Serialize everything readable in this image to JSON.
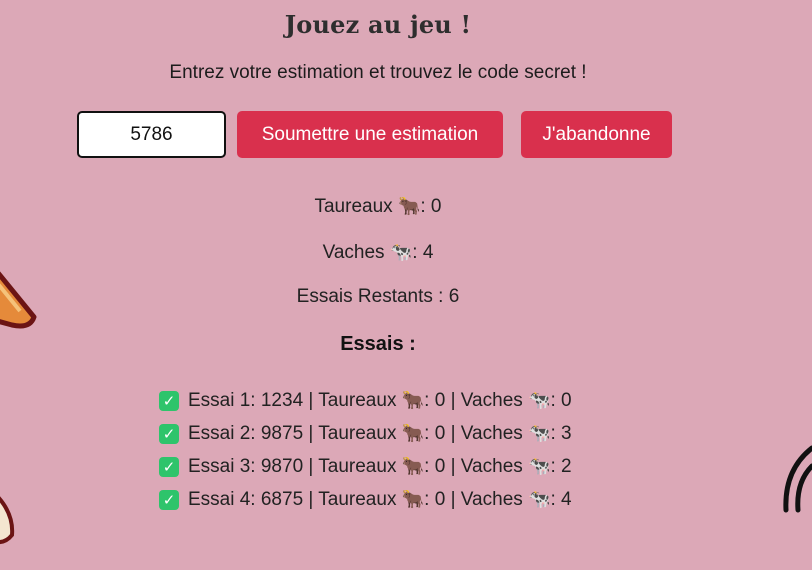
{
  "game": {
    "title": "Jouez au jeu !",
    "instructions": "Entrez votre estimation et trouvez le code secret !",
    "guess_value": "5786",
    "submit_label": "Soumettre une estimation",
    "give_up_label": "J'abandonne"
  },
  "stats": {
    "bulls_label": "Taureaux",
    "bull_icon": "🐂",
    "bulls_value": "0",
    "cows_label": "Vaches",
    "cow_icon": "🐄",
    "cows_value": "4",
    "remaining_label": "Essais Restants :",
    "remaining_value": "6"
  },
  "history": {
    "title": "Essais :",
    "check_icon": "check-box-icon",
    "attempts": [
      {
        "label": "Essai 1: 1234 | Taureaux",
        "bulls": "0",
        "cows_label": "| Vaches",
        "cows": "0"
      },
      {
        "label": "Essai 2: 9875 | Taureaux",
        "bulls": "0",
        "cows_label": "| Vaches",
        "cows": "3"
      },
      {
        "label": "Essai 3: 9870 | Taureaux",
        "bulls": "0",
        "cows_label": "| Vaches",
        "cows": "2"
      },
      {
        "label": "Essai 4: 6875 | Taureaux",
        "bulls": "0",
        "cows_label": "| Vaches",
        "cows": "4"
      }
    ]
  },
  "theme": {
    "background": "#dca8b7",
    "button": "#d9304d",
    "check": "#2ec46b"
  }
}
